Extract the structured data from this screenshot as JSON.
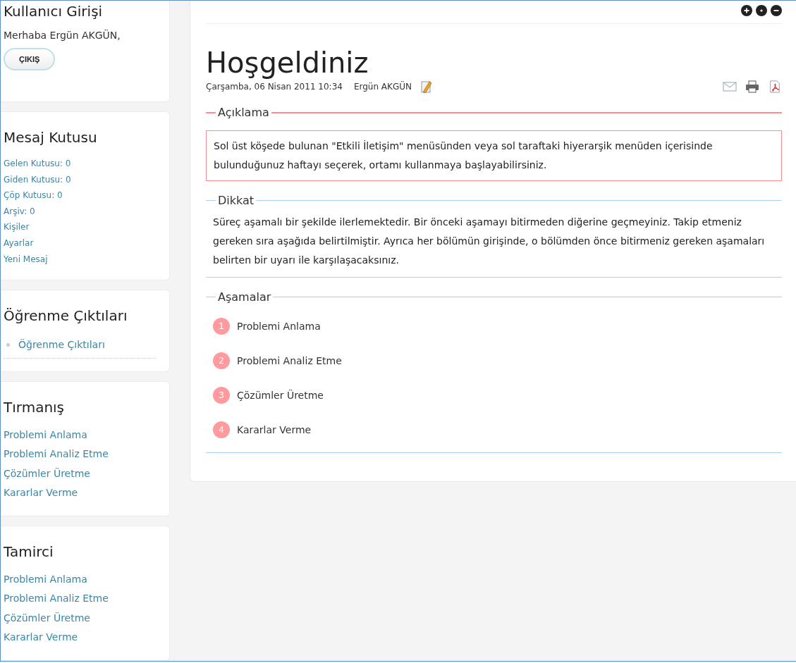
{
  "sidebar": {
    "cards": [
      {
        "kind": "login",
        "title": "Kullanıcı Girişi",
        "greeting": "Merhaba Ergün AKGÜN,",
        "button": "ÇIKIŞ"
      },
      {
        "kind": "mailbox",
        "title": "Mesaj Kutusu",
        "items": [
          "Gelen Kutusu: 0",
          "Giden Kutusu: 0",
          "Çöp Kutusu: 0",
          "Arşiv: 0",
          "Kişiler",
          "Ayarlar",
          "Yeni Mesaj"
        ]
      },
      {
        "kind": "bullets",
        "title": "Öğrenme Çıktıları",
        "items": [
          "Öğrenme Çıktıları"
        ]
      },
      {
        "kind": "links",
        "title": "Tırmanış",
        "items": [
          "Problemi Anlama",
          "Problemi Analiz Etme",
          "Çözümler Üretme",
          "Kararlar Verme"
        ]
      },
      {
        "kind": "links",
        "title": "Tamirci",
        "items": [
          "Problemi Anlama",
          "Problemi Analiz Etme",
          "Çözümler Üretme",
          "Kararlar Verme"
        ]
      }
    ]
  },
  "article": {
    "title": "Hoşgeldiniz",
    "date": "Çarşamba, 06 Nisan 2011 10:34",
    "author": "Ergün AKGÜN",
    "sections": [
      {
        "kind": "boxed",
        "legend": "Açıklama",
        "color": "#ff8c94",
        "text": "Sol üst köşede bulunan \"Etkili İletişim\" menüsünden veya sol taraftaki hiyerarşik menüden içerisinde bulunduğunuz haftayı seçerek, ortamı kullanmaya başlayabilirsiniz."
      },
      {
        "kind": "text",
        "legend": "Dikkat",
        "color": "#a8d1f5",
        "text": "Süreç aşamalı bir şekilde ilerlemektedir. Bir önceki aşamayı bitirmeden diğerine geçmeyiniz. Takip etmeniz gereken sıra aşağıda belirtilmiştir. Ayrıca her bölümün girişinde, o bölümden önce bitirmeniz gereken aşamaları belirten bir uyarı ile karşılaşacaksınız."
      },
      {
        "kind": "steps",
        "legend": "Aşamalar",
        "color": "#a8d1f5",
        "steps": [
          {
            "number": "1",
            "label": "Problemi Anlama"
          },
          {
            "number": "2",
            "label": "Problemi Analiz Etme"
          },
          {
            "number": "3",
            "label": "Çözümler Üretme"
          },
          {
            "number": "4",
            "label": "Kararlar Verme"
          }
        ]
      }
    ]
  }
}
